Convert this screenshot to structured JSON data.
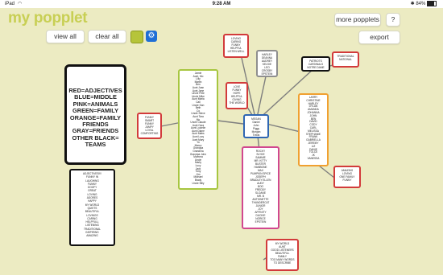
{
  "status_bar": {
    "device": "iPad",
    "time": "9:28 AM",
    "battery": "84%"
  },
  "app_title": "my popplet",
  "toolbar": {
    "view_all": "view all",
    "clear_all": "clear all",
    "more_popplets": "more popplets",
    "help": "?",
    "export": "export"
  },
  "colors": {
    "background": "#ecebc2",
    "accent_green": "#c8cf54",
    "swatch_green": "#b6c43a",
    "swatch_blue": "#1f6fd6"
  },
  "icons": {
    "settings": "gear-icon",
    "wifi": "wifi-icon",
    "bluetooth": "bluetooth-icon",
    "battery": "battery-icon"
  },
  "popplets": {
    "legend": "RED=ADJECTIVES\nBLUE=MIDDLE\nPINK=ANIMALS\nGREEN=FAMILY\nORANGE=FAMILY\nFRIENDS\nGRAY=FRIENDS\nOTHER BLACK=\nTEAMS",
    "adjectives_list": "ADJECTIVES!!!!\nFUNNY IN\nLAUGHING\nFUNNY\nGOOFY\nGREAT\nLOVING\nADORES\nHAPPY\nMY WORLD\nQUIETS\nBEAUTIFUL\nLOVINGS\nCARING\nHELPFULL\nLISTENING\nTRADITIONAL\nINSPIRING\nAMAZING",
    "center": "MEGAN\nDaniel\nJohn\nPiggy\nMorgan\nTravis",
    "family_green": "Jamie\nAunt. Mo\nLilly\nMartin\nBen\nAunt Joan\nAunt Jane\nUncle Pete\nUncle Mike\nAunt Maria\nCali\nUncle Dan\nBeth\nCo\nUncle Steve\nAunt Tara\nMo\nUncle Claude\nAunt Cara\nAunt Lucielle\nAunt Diane\nAunt Mabs\nAunt Lucy\nAunt Mary\nYo\nMarco\nGrandpa\nGrandma\nGrandpa John\nMumma\nUncle\nMarty\nLucy\nJack\nTony\nJim\nMichael\nBrady\nUncle Billy",
    "funny_red": "FUNNY\nSMART\nFUNNY\nJUMPY\nLOYAL\nCOMFORTING",
    "loving_red": "LOVING\nCARING\nFUNNY\nHELPFUL\nLISTEN WELL",
    "gray_friends": "HARLEY\nDEANNA\nAUDREY\nKELSIE\nLEO\nCROSBY\nEPSTEIN",
    "love_red": "LOVE\nFUNNY\nHOPE\nHELPFUL\nGIVING\nTHE WORLD",
    "patriots": "PATRIOTS\nCARDINALS\nNOTRE DAME",
    "traditional": "TRADITIONAL\nNATIONAL",
    "orange_friends": "LARRY\nCHRISTINE\nHARLEY\nDYLAN\nAMANDA\nJOHANNA\nJOHN\nBEN\nDAVID\nCODY\nCARL\nMELISSA\nSTEPHANIE\nFRANK\nGABRIELLA\nJEREMY\nLIZ\nDANIE\nTOLCE\nJK\nVANESSA",
    "amazing": "AMAZING\nLOVING\nONE FAMILY\nFUNNY",
    "animals_pink": "ROCKY\nSLYDE\nSAMMIE\nMR. KITTY\nBUSTER\nHAMBONE\nMAX\nPUMPKIN SPICE\nJOSEPH\nBRADLEY ELLEN\nAUDY\nBOO\nFREDDY\nSLOANE\nMR. B\nANTOINETTE\nTHUNDERCAT\nJUNIOR\nJOY\nAFFINITY\nDUCKIE\nNORICE\nEPSTEIN",
    "my_world": "MY WORLD\nAUNT\nGOOD LISTENERS\nBEAUTIFUL\nFAMILY\nTOO MANY WORDS\nTO DESCRIBE"
  }
}
